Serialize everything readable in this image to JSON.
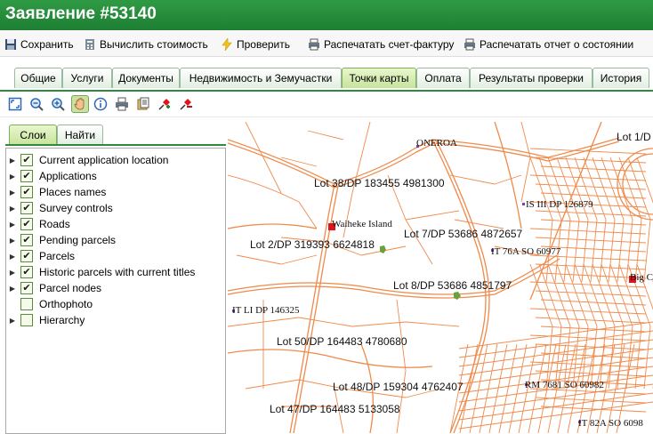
{
  "title": "Заявление #53140",
  "actions": [
    {
      "label": "Сохранить",
      "icon": "save-icon"
    },
    {
      "label": "Вычислить стоимость",
      "icon": "calculator-icon"
    },
    {
      "label": "Проверить",
      "icon": "lightning-icon"
    },
    {
      "label": "Распечатать счет-фактуру",
      "icon": "printer-icon"
    },
    {
      "label": "Распечатать отчет о состоянии",
      "icon": "printer-icon"
    }
  ],
  "tabs": [
    {
      "label": "Общие"
    },
    {
      "label": "Услуги"
    },
    {
      "label": "Документы"
    },
    {
      "label": "Недвижимость и Земучастки"
    },
    {
      "label": "Точки карты"
    },
    {
      "label": "Оплата"
    },
    {
      "label": "Результаты проверки"
    },
    {
      "label": "История"
    }
  ],
  "active_tab": "Точки карты",
  "map_tools": [
    "fit-extent-icon",
    "zoom-out-icon",
    "zoom-in-icon",
    "pan-hand-icon",
    "info-icon",
    "print-icon",
    "layers-icon",
    "add-point-icon",
    "remove-point-icon"
  ],
  "panel_tabs": [
    {
      "label": "Слои"
    },
    {
      "label": "Найти"
    }
  ],
  "layers": [
    {
      "label": "Current application location",
      "checked": true,
      "expandable": true
    },
    {
      "label": "Applications",
      "checked": true,
      "expandable": true
    },
    {
      "label": "Places names",
      "checked": true,
      "expandable": true
    },
    {
      "label": "Survey controls",
      "checked": true,
      "expandable": true
    },
    {
      "label": "Roads",
      "checked": true,
      "expandable": true
    },
    {
      "label": "Pending parcels",
      "checked": true,
      "expandable": true
    },
    {
      "label": "Parcels",
      "checked": true,
      "expandable": true
    },
    {
      "label": "Historic parcels with current titles",
      "checked": true,
      "expandable": true
    },
    {
      "label": "Parcel nodes",
      "checked": true,
      "expandable": true
    },
    {
      "label": "Orthophoto",
      "checked": false,
      "expandable": false
    },
    {
      "label": "Hierarchy",
      "checked": false,
      "expandable": true
    }
  ],
  "map_labels": [
    {
      "text": "ONEROA",
      "style": "serif"
    },
    {
      "text": "Lot 1/D",
      "style": "sans"
    },
    {
      "text": "Lot 38/DP 183455 4981300",
      "style": "sans"
    },
    {
      "text": "IS III DP 126879",
      "style": "serif"
    },
    {
      "text": "Waiheke Island",
      "style": "serif"
    },
    {
      "text": "Lot 7/DP 53686 4872657",
      "style": "sans"
    },
    {
      "text": "Lot 2/DP 319393 6624818",
      "style": "sans"
    },
    {
      "text": "IT 76A SO 60977",
      "style": "serif"
    },
    {
      "text": "Big C",
      "style": "serif"
    },
    {
      "text": "Lot 8/DP 53686 4851797",
      "style": "sans"
    },
    {
      "text": "IT LI DP 146325",
      "style": "serif"
    },
    {
      "text": "Lot 50/DP 164483 4780680",
      "style": "sans"
    },
    {
      "text": "RM 7681 SO 60982",
      "style": "serif"
    },
    {
      "text": "Lot 48/DP 159304 4762407",
      "style": "sans"
    },
    {
      "text": "Lot 47/DP 164483 5133058",
      "style": "sans"
    },
    {
      "text": "IT 82A SO 6098",
      "style": "serif"
    }
  ],
  "colors": {
    "accent": "#2f8a3e",
    "parcel_lines": "#f08a4b",
    "marker_red": "#e0141a",
    "marker_green": "#6aa13a"
  }
}
